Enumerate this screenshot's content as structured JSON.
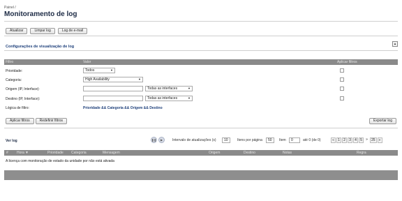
{
  "breadcrumb": "Painel /",
  "page_title": "Monitoramento de log",
  "toolbar": {
    "refresh": "Atualizar",
    "clear": "Limpar log",
    "email": "Log de e-mail"
  },
  "filter_section": {
    "title": "Configurações de visualização de log",
    "collapse_glyph": "▴",
    "headers": {
      "filter": "Filtro",
      "value": "Valor",
      "apply": "Aplicar filtros"
    },
    "rows": {
      "priority": {
        "label": "Prioridade:",
        "value": "Todos"
      },
      "category": {
        "label": "Categoria:",
        "value": "High Availability"
      },
      "source": {
        "label": "Origem (IP, Interface):",
        "interface": "Todas as interfaces"
      },
      "destination": {
        "label": "Destino (IP, Interface):",
        "interface": "Todas as interfaces"
      },
      "logic": {
        "label": "Lógica de filtro:",
        "value": "Prioridade && Categoria && Origem && Destino"
      }
    },
    "apply_button": "Aplicar filtros",
    "reset_button": "Redefinir filtros",
    "export_button": "Exportar log"
  },
  "log_view": {
    "title": "Ver log",
    "refresh_label": "Intervalo de atualizações (s)",
    "refresh_value": "10",
    "per_page_label": "Itens por página",
    "per_page_value": "50",
    "item_label": "Item",
    "item_value": "0",
    "range_text": "até 0 (de 0)",
    "pages": [
      "1",
      "2",
      "3",
      "4",
      "5"
    ],
    "last_page": "25",
    "columns": {
      "num": "#",
      "time": "Hora",
      "priority": "Prioridade",
      "category": "Categoria",
      "message": "Mensagem",
      "source": "Origem",
      "destination": "Destino",
      "notes": "Notas",
      "rule": "Regra"
    },
    "message": "A licença com monitoração de estado da unidade por não está ativada"
  }
}
